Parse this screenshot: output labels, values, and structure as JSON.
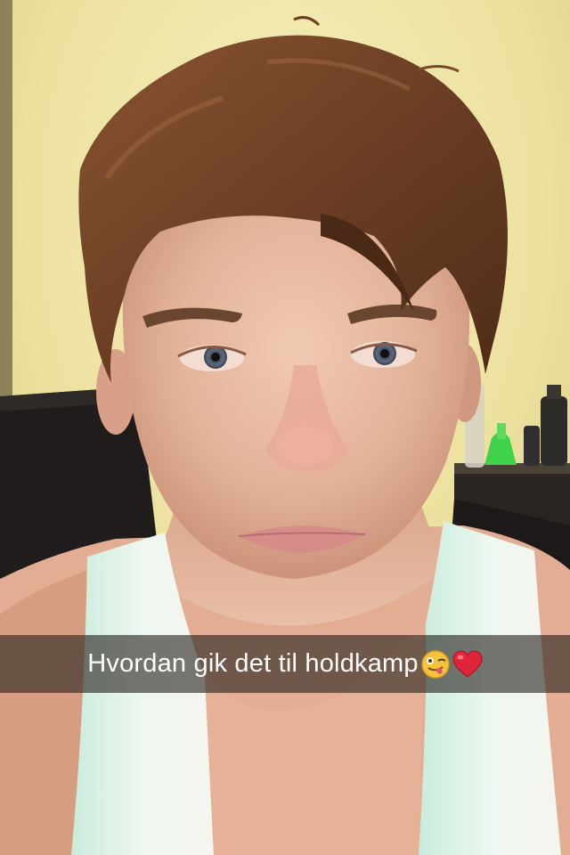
{
  "caption": {
    "text": "Hvordan gik det til holdkamp",
    "emojis": [
      "winking-face-with-tongue-icon",
      "red-heart-icon"
    ]
  },
  "colors": {
    "wall": "#efe6a4",
    "skin": "#e6b8a0",
    "hair": "#6e4126",
    "shirt": "#dff2ea",
    "chair": "#1f1c1b",
    "bottle_green": "#3fd24a",
    "caption_bar": "#28241e"
  }
}
